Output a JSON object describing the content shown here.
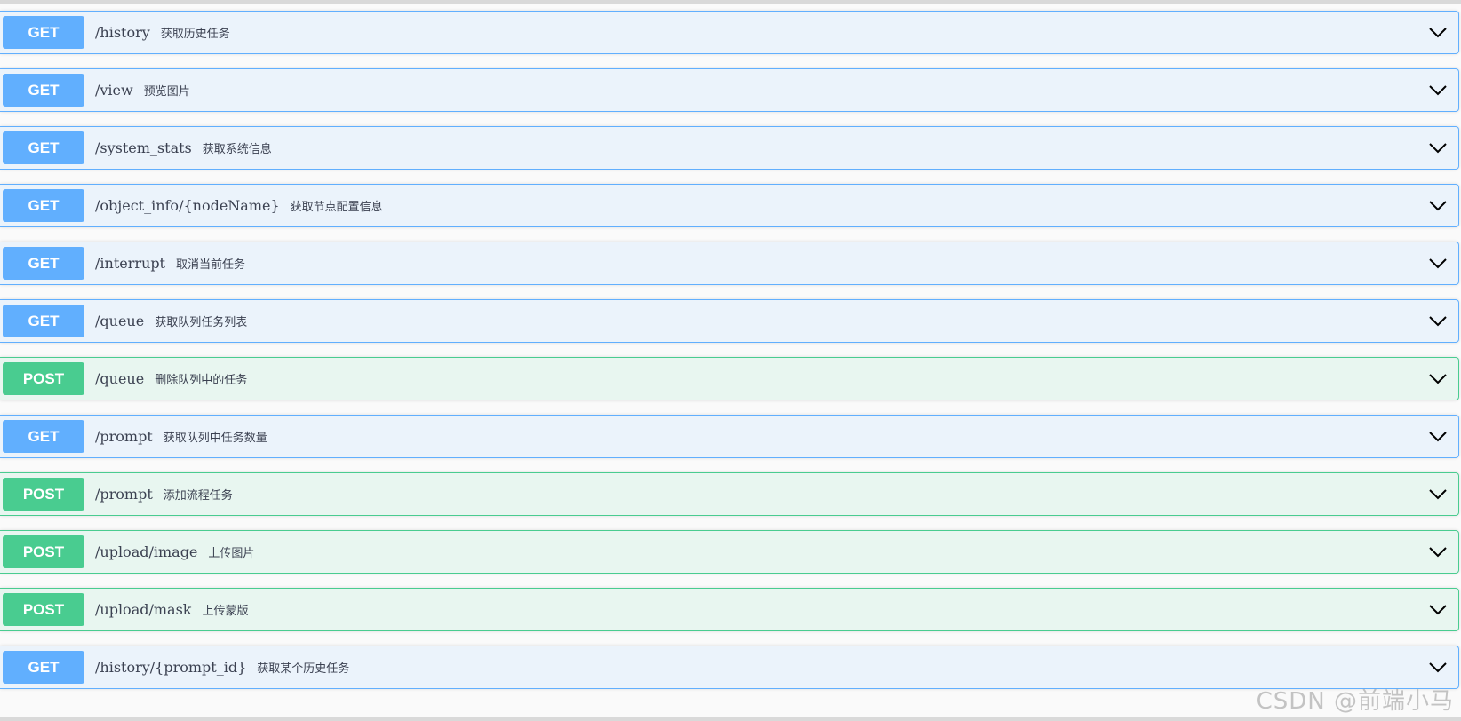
{
  "operations": [
    {
      "method": "GET",
      "path": "/history",
      "summary": "获取历史任务"
    },
    {
      "method": "GET",
      "path": "/view",
      "summary": "预览图片"
    },
    {
      "method": "GET",
      "path": "/system_stats",
      "summary": "获取系统信息"
    },
    {
      "method": "GET",
      "path": "/object_info/{nodeName}",
      "summary": "获取节点配置信息"
    },
    {
      "method": "GET",
      "path": "/interrupt",
      "summary": "取消当前任务"
    },
    {
      "method": "GET",
      "path": "/queue",
      "summary": "获取队列任务列表"
    },
    {
      "method": "POST",
      "path": "/queue",
      "summary": "删除队列中的任务"
    },
    {
      "method": "GET",
      "path": "/prompt",
      "summary": "获取队列中任务数量"
    },
    {
      "method": "POST",
      "path": "/prompt",
      "summary": "添加流程任务"
    },
    {
      "method": "POST",
      "path": "/upload/image",
      "summary": "上传图片"
    },
    {
      "method": "POST",
      "path": "/upload/mask",
      "summary": "上传蒙版"
    },
    {
      "method": "GET",
      "path": "/history/{prompt_id}",
      "summary": "获取某个历史任务"
    }
  ],
  "watermark": "CSDN @前端小马",
  "icons": {
    "expand": "chevron-down-icon"
  },
  "colors": {
    "get": "#61affe",
    "get_bg": "#ebf3fb",
    "post": "#49cc90",
    "post_bg": "#e8f6f0"
  }
}
